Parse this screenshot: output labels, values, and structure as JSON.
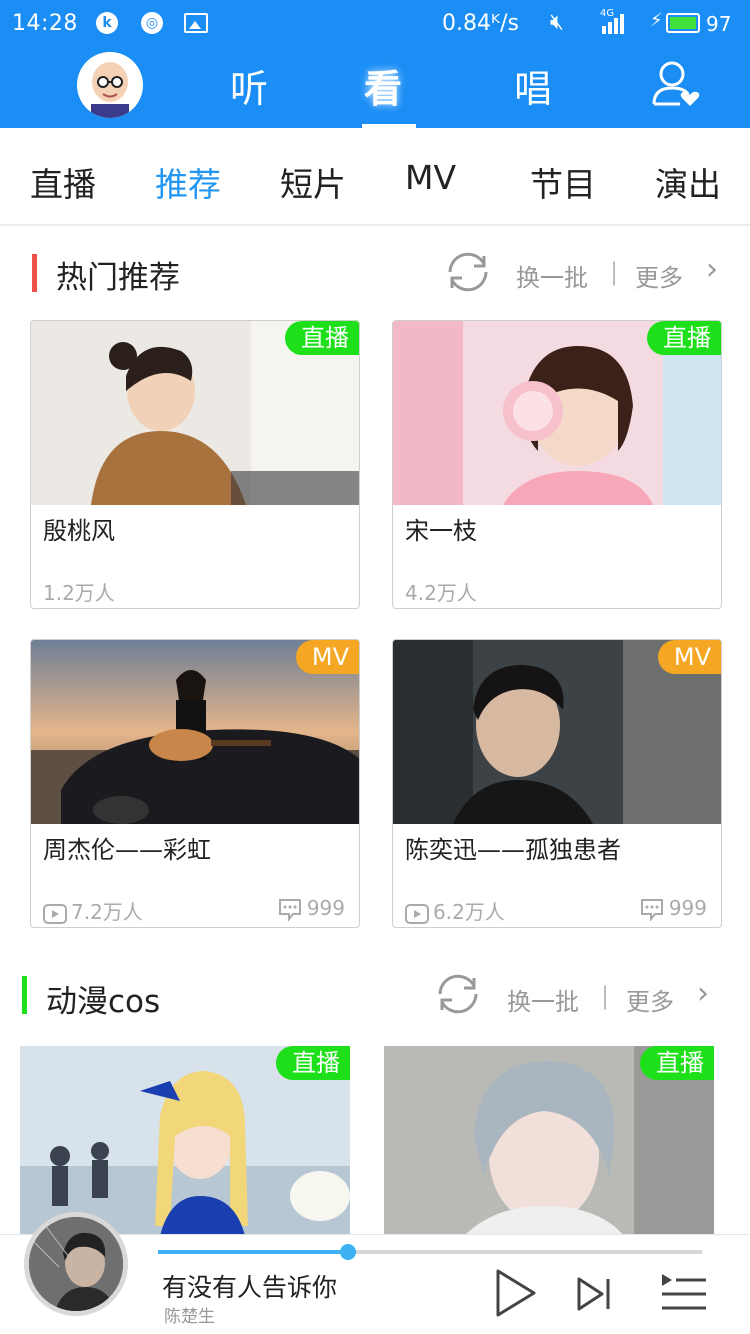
{
  "status_bar": {
    "time": "14:28",
    "app_icons": [
      "k-icon",
      "circle-app-icon",
      "image-icon"
    ],
    "speed": "0.84ᴷ/s",
    "network": "4G",
    "battery_level": "97"
  },
  "header": {
    "tabs": [
      {
        "label": "听",
        "active": false
      },
      {
        "label": "看",
        "active": true
      },
      {
        "label": "唱",
        "active": false
      }
    ]
  },
  "subtabs": [
    {
      "label": "直播",
      "active": false
    },
    {
      "label": "推荐",
      "active": true
    },
    {
      "label": "短片",
      "active": false
    },
    {
      "label": "MV",
      "active": false
    },
    {
      "label": "节目",
      "active": false
    },
    {
      "label": "演出",
      "active": false
    }
  ],
  "sections": [
    {
      "title": "热门推荐",
      "bar_color": "#f0524a",
      "refresh_label": "换一批",
      "separator": "|",
      "more_label": "更多",
      "cards": [
        {
          "badge": "直播",
          "title": "殷桃风",
          "viewers": "1.2万人"
        },
        {
          "badge": "直播",
          "title": "宋一枝",
          "viewers": "4.2万人"
        },
        {
          "badge": "MV",
          "title": "周杰伦——彩虹",
          "views": "7.2万人",
          "comments": "999"
        },
        {
          "badge": "MV",
          "title": "陈奕迅——孤独患者",
          "views": "6.2万人",
          "comments": "999"
        }
      ]
    },
    {
      "title": "动漫cos",
      "bar_color": "#1ee01a",
      "refresh_label": "换一批",
      "separator": "|",
      "more_label": "更多",
      "cards": [
        {
          "badge": "直播"
        },
        {
          "badge": "直播"
        }
      ]
    }
  ],
  "player": {
    "song": "有没有人告诉你",
    "artist": "陈楚生",
    "progress_fraction": 0.35
  },
  "colors": {
    "header_blue": "#1a8ef5",
    "active_tab": "#2196f3",
    "live_badge": "#1ee01a",
    "mv_badge": "#f5a623",
    "progress": "#3db1f2"
  }
}
